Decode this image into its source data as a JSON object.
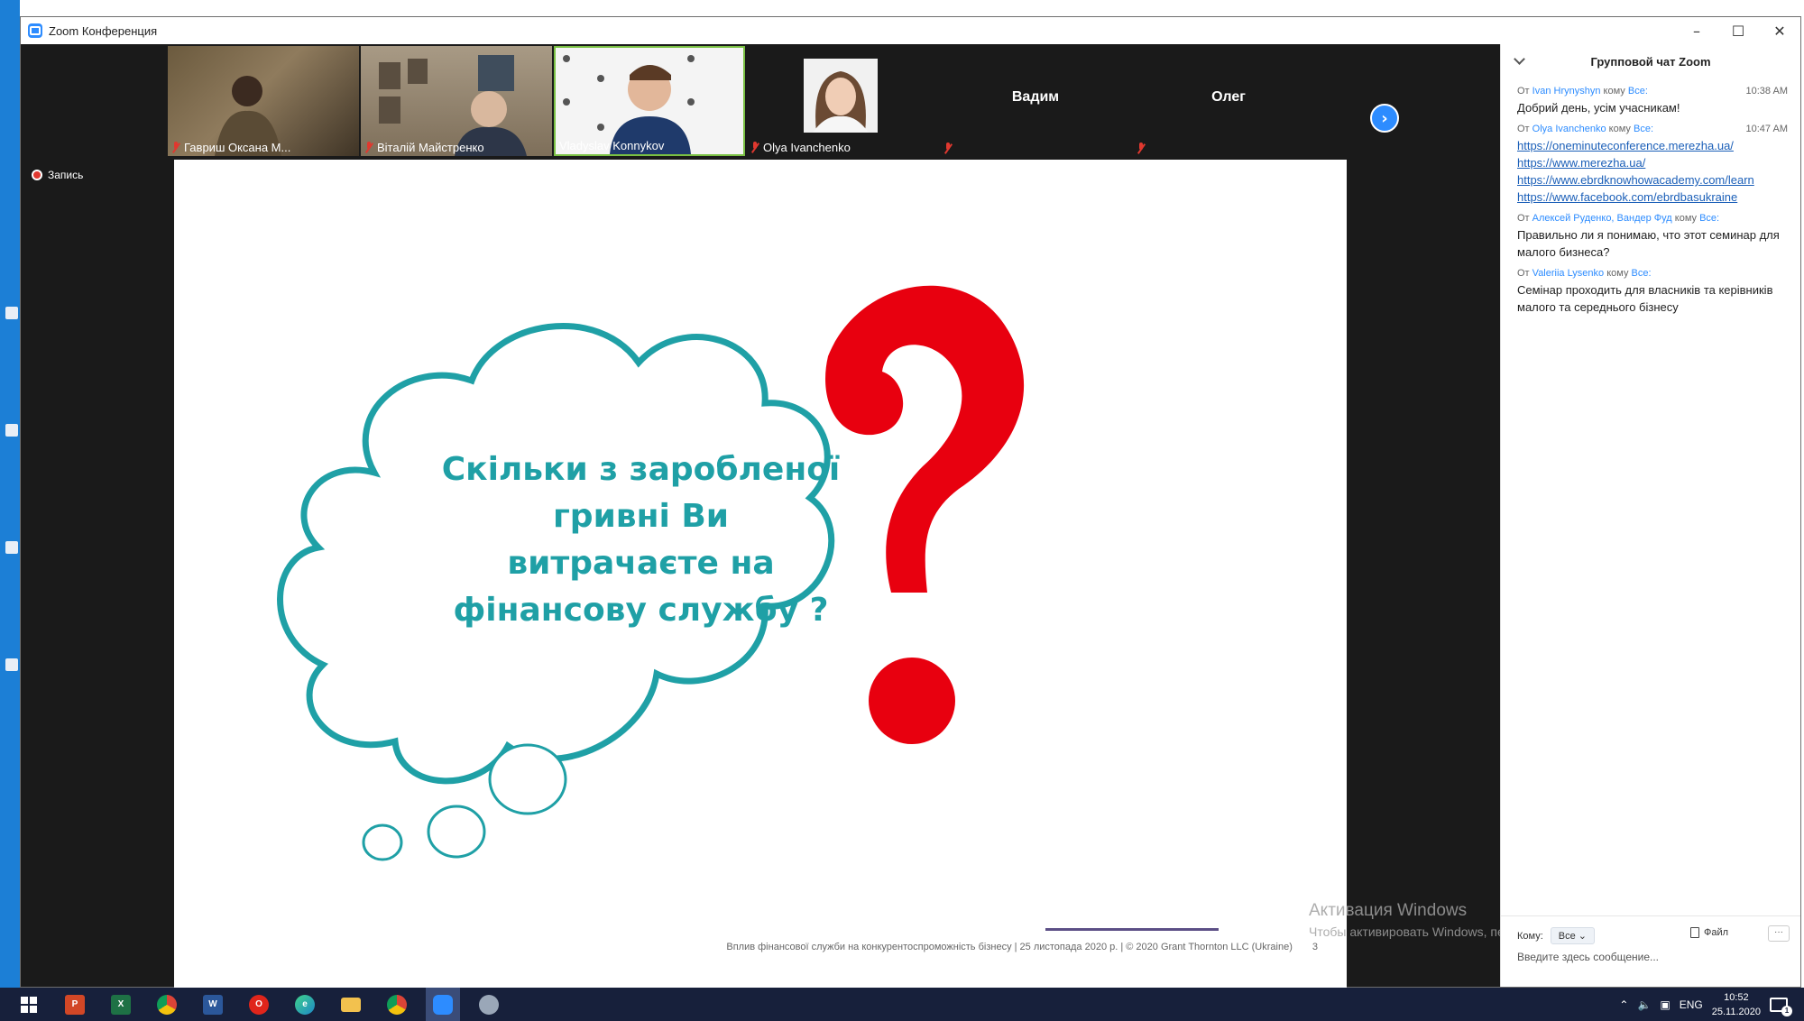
{
  "window": {
    "title": "Zoom Конференция"
  },
  "recording": {
    "label": "Запись"
  },
  "gallery": {
    "tiles": [
      {
        "name": "Гавриш Оксана М...",
        "muted": true
      },
      {
        "name": "Віталій Майстренко",
        "muted": true
      },
      {
        "name": "Vladyslav Konnykov",
        "muted": false,
        "active": true
      },
      {
        "name": "Olya Ivanchenko",
        "muted": true
      },
      {
        "name": "Вадим",
        "muted": true
      },
      {
        "name": "Олег",
        "muted": true
      }
    ]
  },
  "slide": {
    "cloud_lines": [
      "Скільки з заробленої",
      "гривні Ви",
      "витрачаєте на",
      "фінансову службу ?"
    ],
    "footer": "Вплив фінансової служби на конкурентоспроможність бізнесу | 25 листопада 2020 р. | © 2020 Grant Thornton LLC (Ukraine)",
    "page_number": "3",
    "cloud_color": "#1fa0a6",
    "question_color": "#e8000f"
  },
  "watermark": {
    "line1": "Активация Windows",
    "line2": "Чтобы активировать Windows, перейдите в раздел \"Параметры\"."
  },
  "chat": {
    "title": "Групповой чат Zoom",
    "messages": [
      {
        "from_prefix": "От",
        "from": "Ivan Hrynyshyn",
        "to_prefix": "кому",
        "to": "Все:",
        "time": "10:38 AM",
        "text": "Добрий день, усім учасникам!"
      },
      {
        "from_prefix": "От",
        "from": "Olya Ivanchenko",
        "to_prefix": "кому",
        "to": "Все:",
        "time": "10:47 AM",
        "links": [
          "https://oneminuteconference.merezha.ua/",
          "https://www.merezha.ua/",
          "https://www.ebrdknowhowacademy.com/learn",
          "https://www.facebook.com/ebrdbasukraine"
        ]
      },
      {
        "from_prefix": "От",
        "from": "Алексей Руденко, Вандер Фуд",
        "to_prefix": "кому",
        "to": "Все:",
        "time": "",
        "text": "Правильно ли я понимаю, что этот семинар для малого бизнеса?"
      },
      {
        "from_prefix": "От",
        "from": "Valeriia Lysenko",
        "to_prefix": "кому",
        "to": "Все:",
        "time": "",
        "text": "Семінар проходить для власників та керівників малого та середнього бізнесу"
      }
    ],
    "footer": {
      "to_label": "Кому:",
      "to_value": "Все",
      "file_label": "Файл",
      "more": "···",
      "placeholder": "Введите здесь сообщение..."
    }
  },
  "taskbar": {
    "apps": [
      {
        "icon": "windows-start-icon"
      },
      {
        "icon": "powerpoint-icon",
        "label": "P",
        "color": "#d24726"
      },
      {
        "icon": "excel-icon",
        "label": "X",
        "color": "#1e7145"
      },
      {
        "icon": "chrome-icon",
        "label": "",
        "color": "#4caf50"
      },
      {
        "icon": "word-icon",
        "label": "W",
        "color": "#2b579a"
      },
      {
        "icon": "opera-icon",
        "label": "O",
        "color": "#e0251b"
      },
      {
        "icon": "edge-icon",
        "label": "e",
        "color": "#1e88c8"
      },
      {
        "icon": "file-explorer-icon",
        "label": "",
        "color": "#f2c14e"
      },
      {
        "icon": "chrome-icon-2",
        "label": "",
        "color": "#4caf50"
      },
      {
        "icon": "zoom-icon",
        "label": "",
        "color": "#2d8cff",
        "active": true
      },
      {
        "icon": "paint-icon",
        "label": "",
        "color": "#9aa7b8"
      }
    ],
    "lang": "ENG",
    "time": "10:52",
    "date": "25.11.2020",
    "notifications": "1"
  }
}
